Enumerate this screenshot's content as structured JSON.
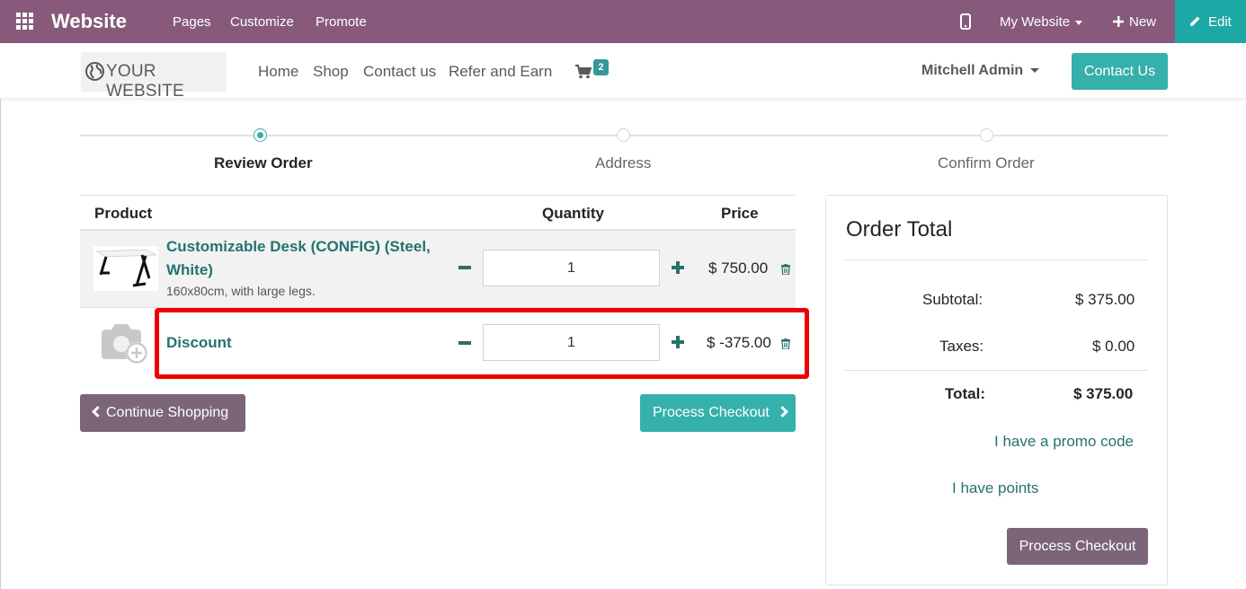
{
  "topbar": {
    "app_name": "Website",
    "menu": [
      "Pages",
      "Customize",
      "Promote"
    ],
    "website_selector": "My Website",
    "new_label": "New",
    "edit_label": "Edit",
    "bg_color": "#875a7b",
    "edit_color": "#1ea8a5"
  },
  "header": {
    "logo_text": "YOUR WEBSITE",
    "nav": [
      "Home",
      "Shop",
      "Contact us",
      "Refer and Earn"
    ],
    "cart_count": "2",
    "user": "Mitchell Admin",
    "contact_button": "Contact Us"
  },
  "steps": [
    {
      "label": "Review Order",
      "active": true
    },
    {
      "label": "Address",
      "active": false
    },
    {
      "label": "Confirm Order",
      "active": false
    }
  ],
  "cart": {
    "columns": {
      "product": "Product",
      "quantity": "Quantity",
      "price": "Price"
    },
    "rows": [
      {
        "name_line1": "Customizable Desk (CONFIG) (Steel,",
        "name_line2": "White)",
        "description": "160x80cm, with large legs.",
        "quantity": "1",
        "price": "$ 750.00",
        "image": "desk-image"
      },
      {
        "name_line1": "Discount",
        "quantity": "1",
        "price": "$ -375.00",
        "image": "camera-placeholder-icon"
      }
    ],
    "continue_label": "Continue Shopping",
    "process_label": "Process Checkout",
    "highlight_color": "#ee0000"
  },
  "order_total": {
    "title": "Order Total",
    "subtotal_label": "Subtotal:",
    "subtotal_value": "$ 375.00",
    "taxes_label": "Taxes:",
    "taxes_value": "$ 0.00",
    "total_label": "Total:",
    "total_value": "$ 375.00",
    "promo_link": "I have a promo code",
    "points_link": "I have points",
    "process_label": "Process Checkout"
  }
}
